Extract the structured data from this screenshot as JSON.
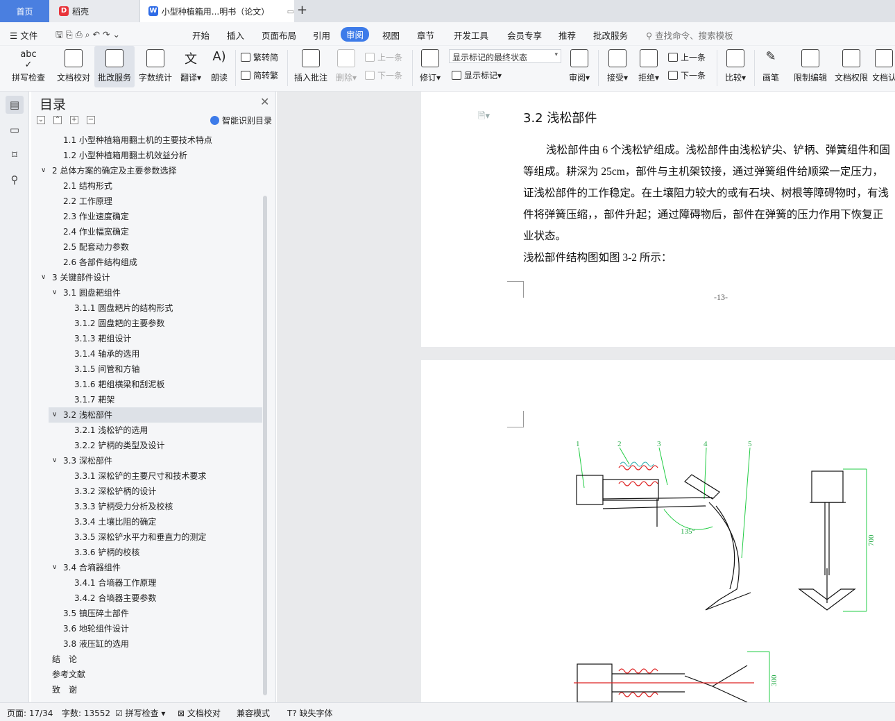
{
  "tabs": {
    "home": "首页",
    "daoke": "稻壳",
    "doc": "小型种植箱用...明书（论文）",
    "new_tab": "+"
  },
  "menu": {
    "file": "文件",
    "items": [
      "开始",
      "插入",
      "页面布局",
      "引用",
      "审阅",
      "视图",
      "章节",
      "开发工具",
      "会员专享",
      "推荐",
      "批改服务"
    ],
    "active": "审阅",
    "search": "查找命令、搜索模板"
  },
  "ribbon": {
    "spell": "拼写检查",
    "proof": "文档校对",
    "correct": "批改服务",
    "wordcount": "字数统计",
    "translate": "翻译",
    "read": "朗读",
    "trad": "繁转简",
    "simp": "简转繁",
    "insert_comment": "插入批注",
    "delete": "删除",
    "prev": "上一条",
    "next": "下一条",
    "revise": "修订",
    "markup_state": "显示标记的最终状态",
    "show_markup": "显示标记",
    "review": "审阅",
    "accept": "接受",
    "reject": "拒绝",
    "prev2": "上一条",
    "next2": "下一条",
    "compare": "比较",
    "pen": "画笔",
    "restrict": "限制编辑",
    "perm": "文档权限",
    "docv": "文档认"
  },
  "toc": {
    "title": "目录",
    "smart": "智能识别目录",
    "items": [
      {
        "text": "1.1 小型种植箱用翻土机的主要技术特点",
        "level": 2
      },
      {
        "text": "1.2 小型种植箱用翻土机效益分析",
        "level": 2
      },
      {
        "text": "2 总体方案的确定及主要参数选择",
        "level": 1,
        "expand": true
      },
      {
        "text": "2.1 结构形式",
        "level": 2
      },
      {
        "text": "2.2 工作原理",
        "level": 2
      },
      {
        "text": "2.3 作业速度确定",
        "level": 2
      },
      {
        "text": "2.4 作业幅宽确定",
        "level": 2
      },
      {
        "text": "2.5 配套动力参数",
        "level": 2
      },
      {
        "text": "2.6 各部件结构组成",
        "level": 2
      },
      {
        "text": "3 关键部件设计",
        "level": 1,
        "expand": true
      },
      {
        "text": "3.1 圆盘耙组件",
        "level": 2,
        "expand": true
      },
      {
        "text": "3.1.1 圆盘耙片的结构形式",
        "level": 3
      },
      {
        "text": "3.1.2 圆盘耙的主要参数",
        "level": 3
      },
      {
        "text": "3.1.3 耙组设计",
        "level": 3
      },
      {
        "text": "3.1.4 轴承的选用",
        "level": 3
      },
      {
        "text": "3.1.5 间管和方轴",
        "level": 3
      },
      {
        "text": "3.1.6 耙组横梁和刮泥板",
        "level": 3
      },
      {
        "text": "3.1.7 耙架",
        "level": 3
      },
      {
        "text": "3.2 浅松部件",
        "level": 2,
        "expand": true,
        "selected": true
      },
      {
        "text": "3.2.1 浅松铲的选用",
        "level": 3
      },
      {
        "text": "3.2.2 铲柄的类型及设计",
        "level": 3
      },
      {
        "text": "3.3 深松部件",
        "level": 2,
        "expand": true
      },
      {
        "text": "3.3.1 深松铲的主要尺寸和技术要求",
        "level": 3
      },
      {
        "text": "3.3.2 深松铲柄的设计",
        "level": 3
      },
      {
        "text": "3.3.3 铲柄受力分析及校核",
        "level": 3
      },
      {
        "text": "3.3.4 土壤比阻的确定",
        "level": 3
      },
      {
        "text": "3.3.5 深松铲水平力和垂直力的测定",
        "level": 3
      },
      {
        "text": "3.3.6 铲柄的校核",
        "level": 3
      },
      {
        "text": "3.4 合墒器组件",
        "level": 2,
        "expand": true
      },
      {
        "text": "3.4.1 合墒器工作原理",
        "level": 3
      },
      {
        "text": "3.4.2 合墒器主要参数",
        "level": 3
      },
      {
        "text": "3.5 镇压碎土部件",
        "level": 2
      },
      {
        "text": "3.6 地轮组件设计",
        "level": 2
      },
      {
        "text": "3.8 液压缸的选用",
        "level": 2
      },
      {
        "text": "结　论",
        "level": 1
      },
      {
        "text": "参考文献",
        "level": 1
      },
      {
        "text": "致　谢",
        "level": 1
      }
    ]
  },
  "document": {
    "heading": "3.2 浅松部件",
    "lines": [
      "浅松部件由 6 个浅松铲组成。浅松部件由浅松铲尖、铲柄、弹簧组件和固",
      "等组成。耕深为 25cm，部件与主机架铰接，通过弹簧组件给顺梁一定压力，",
      "证浅松部件的工作稳定。在土壤阻力较大的或有石块、树根等障碍物时，有浅",
      "件将弹簧压缩，，部件升起；通过障碍物后，部件在弹簧的压力作用下恢复正",
      "业状态。",
      "浅松部件结构图如图 3-2 所示："
    ],
    "page_number": "-13-",
    "drawing": {
      "callouts": [
        "1",
        "2",
        "3",
        "4",
        "5"
      ],
      "angle": "135°",
      "dim_height": "700",
      "dim_width": "300"
    }
  },
  "status": {
    "page": "页面: 17/34",
    "words": "字数: 13552",
    "spell": "拼写检查",
    "proof": "文档校对",
    "compat": "兼容模式",
    "missing_font": "缺失字体"
  },
  "colors": {
    "accent": "#3d7be9",
    "home_tab": "#4a7fe0",
    "daoke_icon": "#e8343a",
    "drawing_green": "#22cc44",
    "drawing_red": "#dd2222"
  }
}
